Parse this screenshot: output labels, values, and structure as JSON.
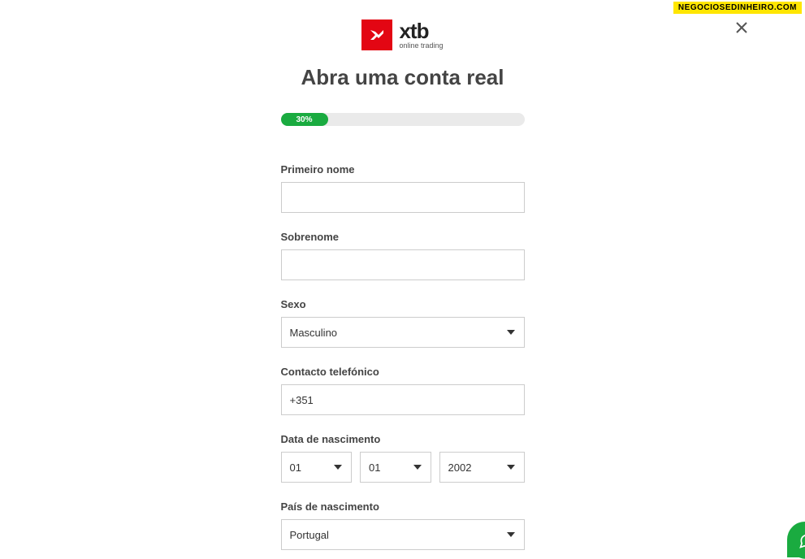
{
  "watermark": "NEGOCIOSEDINHEIRO.COM",
  "logo": {
    "main": "xtb",
    "sub": "online trading"
  },
  "title": "Abra uma conta real",
  "progress": {
    "percent": "30%"
  },
  "form": {
    "first_name": {
      "label": "Primeiro nome",
      "value": ""
    },
    "last_name": {
      "label": "Sobrenome",
      "value": ""
    },
    "gender": {
      "label": "Sexo",
      "value": "Masculino"
    },
    "phone": {
      "label": "Contacto telefónico",
      "value": "+351"
    },
    "birth_date": {
      "label": "Data de nascimento",
      "day": "01",
      "month": "01",
      "year": "2002"
    },
    "birth_country": {
      "label": "País de nascimento",
      "value": "Portugal"
    }
  }
}
